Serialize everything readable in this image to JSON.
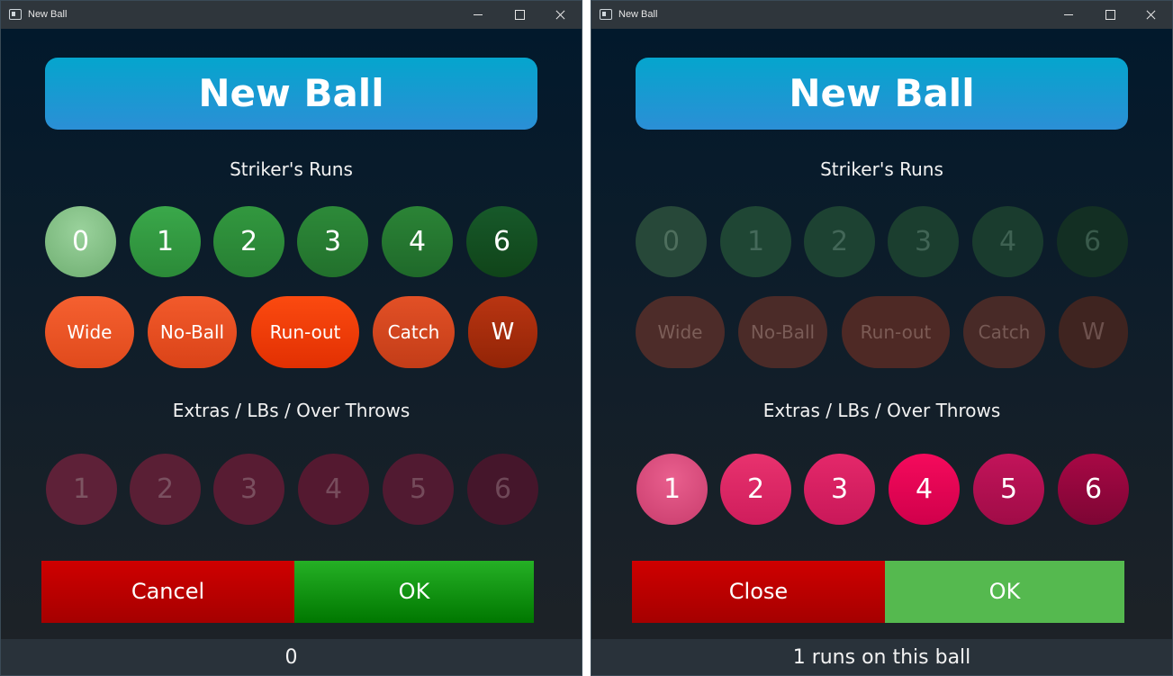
{
  "left": {
    "window_title": "New Ball",
    "header": "New Ball",
    "strikers_runs_label": "Striker's Runs",
    "runs": [
      "0",
      "1",
      "2",
      "3",
      "4",
      "6"
    ],
    "dismissals": [
      "Wide",
      "No-Ball",
      "Run-out",
      "Catch",
      "W"
    ],
    "extras_label": "Extras / LBs / Over Throws",
    "extras": [
      "1",
      "2",
      "3",
      "4",
      "5",
      "6"
    ],
    "cancel_label": "Cancel",
    "ok_label": "OK",
    "status": "0"
  },
  "right": {
    "window_title": "New Ball",
    "header": "New Ball",
    "strikers_runs_label": "Striker's Runs",
    "runs": [
      "0",
      "1",
      "2",
      "3",
      "4",
      "6"
    ],
    "dismissals": [
      "Wide",
      "No-Ball",
      "Run-out",
      "Catch",
      "W"
    ],
    "extras_label": "Extras / LBs / Over Throws",
    "extras": [
      "1",
      "2",
      "3",
      "4",
      "5",
      "6"
    ],
    "cancel_label": "Close",
    "ok_label": "OK",
    "status": "1 runs on this ball"
  },
  "colors": {
    "header_gradient": [
      "#05a5cd",
      "#2b8fd6"
    ],
    "runs_green": [
      "#84c787",
      "#2f9c3e",
      "#2a8c37",
      "#267a30",
      "#237230",
      "#134e1f"
    ],
    "dismissal_orange": [
      "#f2562a",
      "#f0522a",
      "#f23c0a",
      "#d44722",
      "#a72f0e"
    ],
    "extras_pink": [
      "#e0457f",
      "#e2296a",
      "#e02069",
      "#ea0a5a",
      "#b81256",
      "#a0053f"
    ],
    "cancel_red": "#cf0000",
    "ok_green": "#25b025"
  }
}
